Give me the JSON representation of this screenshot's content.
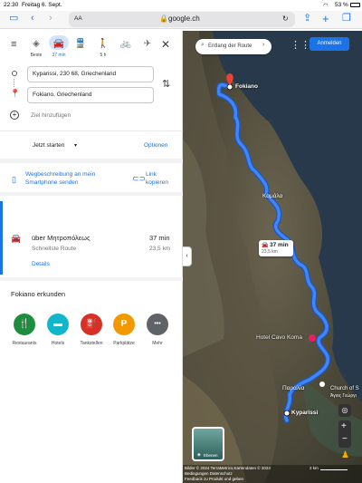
{
  "statusbar": {
    "time": "22:30",
    "date": "Freitag 6. Sept.",
    "battery": "53 %"
  },
  "browser": {
    "aa_label": "AA",
    "url": "google.ch"
  },
  "modes": [
    {
      "name": "best",
      "label": "Beste"
    },
    {
      "name": "car",
      "label": "37 min"
    },
    {
      "name": "transit",
      "label": ""
    },
    {
      "name": "walk",
      "label": "5 h"
    },
    {
      "name": "bike",
      "label": ""
    },
    {
      "name": "flight",
      "label": ""
    }
  ],
  "directions": {
    "origin": "Kyparissi, 230 68, Griechenland",
    "destination": "Fokiano, Griechenland",
    "add_stop": "Ziel hinzufügen",
    "start_now": "Jetzt starten",
    "options": "Optionen",
    "send_to_phone": "Wegbeschreibung an mein Smartphone senden",
    "copy_link": "Link kopieren"
  },
  "route": {
    "via": "über Μητροπόλεως",
    "duration": "37 min",
    "subtitle": "Schnellste Route",
    "distance": "23,5 km",
    "details": "Details"
  },
  "explore": {
    "title": "Fokiano erkunden",
    "items": [
      {
        "label": "Restaurants",
        "color": "#1e8e3e",
        "glyph": "🍴"
      },
      {
        "label": "Hotels",
        "color": "#12b5cb",
        "glyph": "▬"
      },
      {
        "label": "Tankstellen",
        "color": "#d93025",
        "glyph": "⛽"
      },
      {
        "label": "Parkplätze",
        "color": "#f29900",
        "glyph": "P"
      },
      {
        "label": "Mehr",
        "color": "#5f6368",
        "glyph": "•••"
      }
    ]
  },
  "map": {
    "search_placeholder": "Entlang der Route",
    "signin": "Anmelden",
    "place_fokiano": "Fokiano",
    "place_kamala": "Καμάλα",
    "route_time": "37 min",
    "route_dist": "23,5 km",
    "hotel": "Hotel Cavo Koma",
    "place_paralia": "Παραλία",
    "church": "Church of S",
    "church_sub": "Άγιος Γεώργι",
    "place_kyparissi": "Kyparissi",
    "layers": "Ebenen",
    "attribution": "Bilder © 2024 TerraMetrics,Kartendaten © 2024",
    "terms": "Bedingungen  Datenschutz",
    "feedback": "Feedback zu Produkt und geben",
    "scale": "2 km"
  },
  "colors": {
    "accent": "#1a73e8",
    "route": "#4285f4"
  }
}
